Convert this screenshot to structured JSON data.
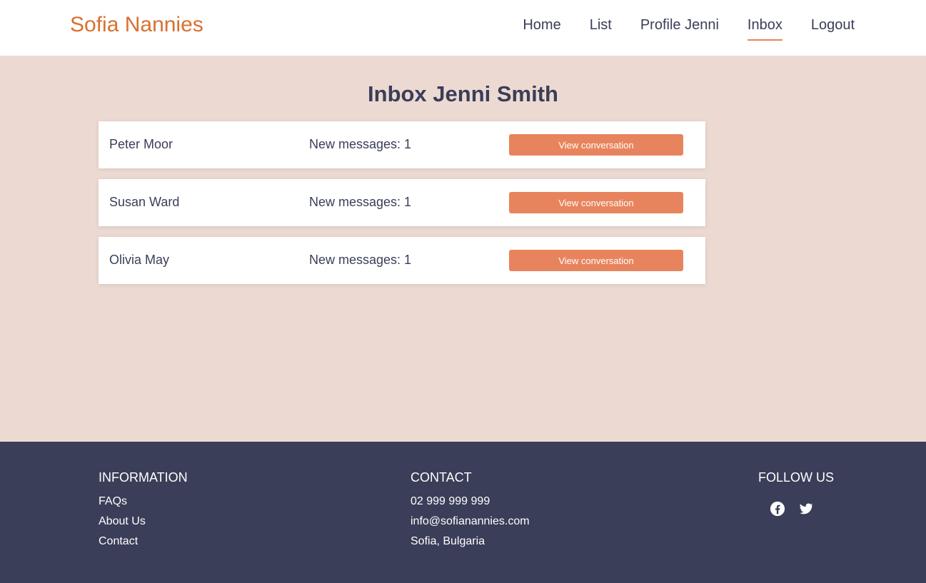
{
  "header": {
    "brand": "Sofia Nannies",
    "nav": [
      {
        "label": "Home"
      },
      {
        "label": "List"
      },
      {
        "label": "Profile Jenni"
      },
      {
        "label": "Inbox",
        "active": true
      },
      {
        "label": "Logout"
      }
    ]
  },
  "main": {
    "title": "Inbox Jenni Smith",
    "conversations": [
      {
        "name": "Peter Moor",
        "messages": "New messages: 1",
        "button": "View conversation"
      },
      {
        "name": "Susan Ward",
        "messages": "New messages: 1",
        "button": "View conversation"
      },
      {
        "name": "Olivia May",
        "messages": "New messages: 1",
        "button": "View conversation"
      }
    ]
  },
  "footer": {
    "information": {
      "heading": "INFORMATION",
      "links": [
        "FAQs",
        "About Us",
        "Contact"
      ]
    },
    "contact": {
      "heading": "CONTACT",
      "phone": "02 999 999 999",
      "email": "info@sofianannies.com",
      "location": "Sofia, Bulgaria"
    },
    "follow": {
      "heading": "FOLLOW US",
      "icons": [
        "facebook-icon",
        "twitter-icon"
      ]
    }
  },
  "colors": {
    "brand": "#d9702f",
    "accent": "#e8845d",
    "background": "#ecdad2",
    "dark": "#3a3e58"
  }
}
